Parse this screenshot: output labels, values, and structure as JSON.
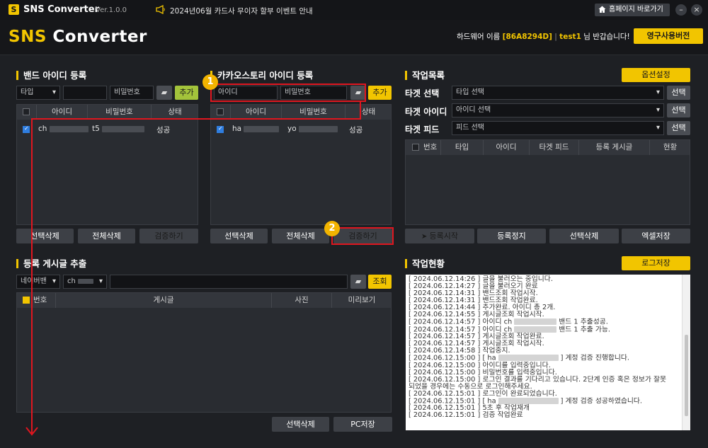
{
  "titlebar": {
    "app_name": "SNS Converter",
    "version": "Ver.1.0.0",
    "notice": "2024년06월 카드사 무이자 할부 이벤트 안내",
    "homepage_btn": "홈페이지 바로가기",
    "minimize": "–",
    "close": "×"
  },
  "header": {
    "brand_a": "SNS",
    "brand_b": "Converter",
    "hw_label": "하드웨어 이름",
    "hw_value": "[86A8294D]",
    "user": "test1",
    "greeting": "님 반갑습니다!",
    "perm_btn": "영구사용버전"
  },
  "band": {
    "title": "밴드 아이디 등록",
    "type_select": "타입",
    "id_input": "",
    "pw_placeholder": "비밀번호",
    "add_btn": "추가",
    "columns": [
      "아이디",
      "비밀번호",
      "상태"
    ],
    "rows": [
      {
        "id": "ch",
        "pw": "t5",
        "status": "성공",
        "checked": true
      }
    ],
    "btn_delete_selected": "선택삭제",
    "btn_delete_all": "전체삭제",
    "btn_verify": "검증하기"
  },
  "kakao": {
    "title": "카카오스토리 아이디 등록",
    "id_placeholder": "아이디",
    "pw_placeholder": "비밀번호",
    "add_btn": "추가",
    "columns": [
      "아이디",
      "비밀번호",
      "상태"
    ],
    "rows": [
      {
        "id": "ha",
        "pw": "yo",
        "status": "성공",
        "checked": true
      }
    ],
    "btn_delete_selected": "선택삭제",
    "btn_delete_all": "전체삭제",
    "btn_verify": "검증하기"
  },
  "tasks": {
    "title": "작업목록",
    "options_btn": "옵션설정",
    "target_select_label": "타겟 선택",
    "target_select_value": "타입 선택",
    "target_id_label": "타겟 아이디",
    "target_id_value": "아이디 선택",
    "target_feed_label": "타겟 피드",
    "target_feed_value": "피드 선택",
    "select_btn": "선택",
    "columns": [
      "번호",
      "타입",
      "아이디",
      "타겟 피드",
      "등록 게시글",
      "현황"
    ],
    "btn_start": "등록시작",
    "btn_stop": "등록정지",
    "btn_delete_selected": "선택삭제",
    "btn_excel": "엑셀저장"
  },
  "extract": {
    "title": "등록 게시글 추출",
    "platform_select": "네이버밴",
    "account_select": "ch",
    "search_btn": "조회",
    "columns": [
      "번호",
      "게시글",
      "사진",
      "미리보기"
    ],
    "btn_delete_selected": "선택삭제",
    "btn_pc_save": "PC저장"
  },
  "status": {
    "title": "작업현황",
    "log_save_btn": "로그저장",
    "log": [
      {
        "t": "[ 2024.06.12.14:26 ]",
        "pre": "글을 불러오는 중입니다.",
        "blur": 0,
        "post": ""
      },
      {
        "t": "[ 2024.06.12.14:27 ]",
        "pre": "글을 불러오기 완료",
        "blur": 0,
        "post": ""
      },
      {
        "t": "[ 2024.06.12.14:31 ]",
        "pre": "밴드조회 작업시작.",
        "blur": 0,
        "post": ""
      },
      {
        "t": "[ 2024.06.12.14:31 ]",
        "pre": "밴드조회 작업완료.",
        "blur": 0,
        "post": ""
      },
      {
        "t": "[ 2024.06.12.14:44 ]",
        "pre": "추가완료. 아이디 총 2개.",
        "blur": 0,
        "post": ""
      },
      {
        "t": "[ 2024.06.12.14:55 ]",
        "pre": "게시글조회 작업시작.",
        "blur": 0,
        "post": ""
      },
      {
        "t": "[ 2024.06.12.14:57 ]",
        "pre": "아이디 ch",
        "blur": 60,
        "post": "밴드 1 추출성공."
      },
      {
        "t": "[ 2024.06.12.14:57 ]",
        "pre": "아이디 ch",
        "blur": 60,
        "post": "밴드 1 추출 가능."
      },
      {
        "t": "[ 2024.06.12.14:57 ]",
        "pre": "게시글조회 작업완료.",
        "blur": 0,
        "post": ""
      },
      {
        "t": "[ 2024.06.12.14:57 ]",
        "pre": "게시글조회 작업시작.",
        "blur": 0,
        "post": ""
      },
      {
        "t": "[ 2024.06.12.14:58 ]",
        "pre": "작업중지.",
        "blur": 0,
        "post": ""
      },
      {
        "t": "[ 2024.06.12.15:00 ]",
        "pre": "[ ha",
        "blur": 85,
        "post": "] 계정 검증 진행합니다."
      },
      {
        "t": "[ 2024.06.12.15:00 ]",
        "pre": "아이디를 입력중입니다.",
        "blur": 0,
        "post": ""
      },
      {
        "t": "[ 2024.06.12.15:00 ]",
        "pre": "비밀번호를 입력중입니다.",
        "blur": 0,
        "post": ""
      },
      {
        "t": "[ 2024.06.12.15:00 ]",
        "pre": "로그인 결과를 기다리고 있습니다. 2단계 인증 혹은 정보가 잘못",
        "blur": 0,
        "post": ""
      },
      {
        "t": "",
        "pre": "되었을 경우에는 수동으로 로그인해주세요.",
        "blur": 0,
        "post": ""
      },
      {
        "t": "[ 2024.06.12.15:01 ]",
        "pre": "로그인이 완료되었습니다.",
        "blur": 0,
        "post": ""
      },
      {
        "t": "[ 2024.06.12.15:01 ]",
        "pre": "[ ha",
        "blur": 85,
        "post": "] 계정 검증 성공하였습니다."
      },
      {
        "t": "[ 2024.06.12.15:01 ]",
        "pre": "5초 후 작업재개",
        "blur": 0,
        "post": ""
      },
      {
        "t": "[ 2024.06.12.15:01 ]",
        "pre": "검증 작업완료",
        "blur": 0,
        "post": ""
      }
    ]
  },
  "callouts": [
    "1",
    "2"
  ],
  "colors": {
    "accent": "#f2c500",
    "green": "#a3c33b",
    "annotation_red": "#e0161f",
    "callout": "#f2b400"
  }
}
